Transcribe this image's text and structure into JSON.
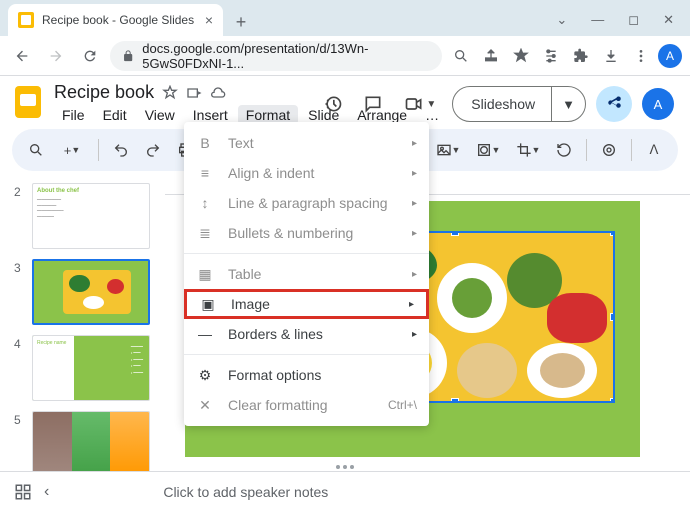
{
  "browser": {
    "tab_title": "Recipe book - Google Slides",
    "url": "docs.google.com/presentation/d/13Wn-5GwS0FDxNI-1...",
    "avatar_initial": "A"
  },
  "doc": {
    "title": "Recipe book",
    "avatar_initial": "A"
  },
  "menubar": [
    "File",
    "Edit",
    "View",
    "Insert",
    "Format",
    "Slide",
    "Arrange",
    "…"
  ],
  "menubar_active_index": 4,
  "toolbar": {
    "slideshow_label": "Slideshow"
  },
  "format_menu": [
    {
      "icon": "B",
      "label": "Text",
      "enabled": false,
      "arrow": true
    },
    {
      "icon": "≡",
      "label": "Align & indent",
      "enabled": false,
      "arrow": true
    },
    {
      "icon": "↕",
      "label": "Line & paragraph spacing",
      "enabled": false,
      "arrow": true
    },
    {
      "icon": "≣",
      "label": "Bullets & numbering",
      "enabled": false,
      "arrow": true
    },
    {
      "sep": true
    },
    {
      "icon": "▦",
      "label": "Table",
      "enabled": false,
      "arrow": true
    },
    {
      "icon": "▣",
      "label": "Image",
      "enabled": true,
      "arrow": true,
      "highlight": true
    },
    {
      "icon": "—",
      "label": "Borders & lines",
      "enabled": true,
      "arrow": true
    },
    {
      "sep": true
    },
    {
      "icon": "⚙",
      "label": "Format options",
      "enabled": true,
      "arrow": false
    },
    {
      "icon": "✕",
      "label": "Clear formatting",
      "enabled": false,
      "arrow": false,
      "shortcut": "Ctrl+\\"
    }
  ],
  "filmstrip": [
    {
      "num": "2",
      "type": "white"
    },
    {
      "num": "3",
      "type": "green",
      "selected": true
    },
    {
      "num": "4",
      "type": "green-split"
    },
    {
      "num": "5",
      "type": "images"
    }
  ],
  "notes": {
    "placeholder": "Click to add speaker notes"
  }
}
